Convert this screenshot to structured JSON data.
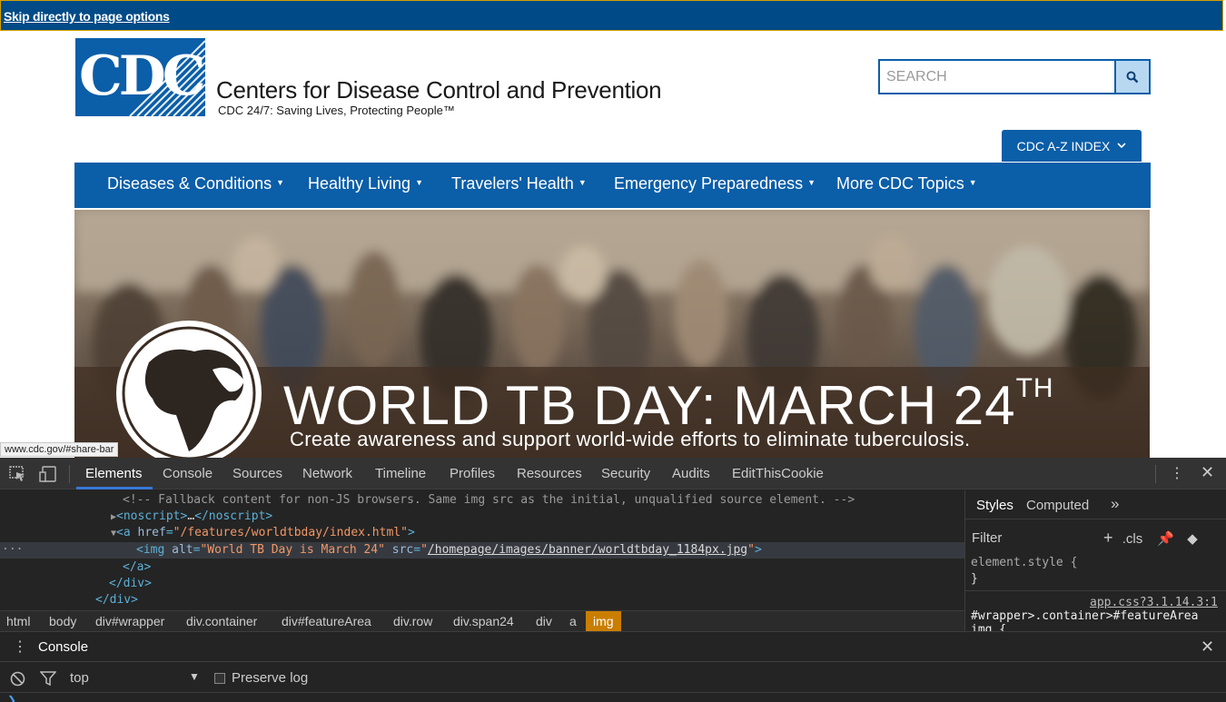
{
  "skip_link": "Skip directly to page options",
  "header": {
    "logo_text": "CDC",
    "org_name": "Centers for Disease Control and Prevention",
    "tagline": "CDC 24/7: Saving Lives, Protecting People™",
    "search_placeholder": "SEARCH",
    "az_index_label": "CDC A-Z INDEX"
  },
  "nav": {
    "items": [
      {
        "label": "Diseases & Conditions"
      },
      {
        "label": "Healthy Living"
      },
      {
        "label": "Travelers' Health"
      },
      {
        "label": "Emergency Preparedness"
      },
      {
        "label": "More CDC Topics"
      }
    ]
  },
  "banner": {
    "title": "WORLD TB DAY: MARCH 24",
    "title_sup": "TH",
    "subtitle": "Create awareness and support world-wide efforts to eliminate tuberculosis."
  },
  "status_url": "www.cdc.gov/#share-bar",
  "devtools": {
    "tabs": [
      "Elements",
      "Console",
      "Sources",
      "Network",
      "Timeline",
      "Profiles",
      "Resources",
      "Security",
      "Audits",
      "EditThisCookie"
    ],
    "active_tab": "Elements",
    "code": {
      "comment": "<!-- Fallback content for non-JS browsers. Same img src as the initial, unqualified source element. -->",
      "noscript_open": "<noscript>",
      "noscript_ellipsis": "…",
      "noscript_close": "</noscript>",
      "a_open": "<a",
      "href_attr": "href",
      "href_val": "\"/features/worldtbday/index.html\"",
      "a_gt": ">",
      "img_open": "<img",
      "alt_attr": "alt",
      "alt_val": "\"World TB Day is March 24\"",
      "src_attr": "src",
      "src_val_q1": "\"",
      "src_val": "/homepage/images/banner/worldtbday_1184px.jpg",
      "src_val_q2": "\"",
      "img_gt": ">",
      "a_close": "</a>",
      "div_close_1": "</div>",
      "div_close_2": "</div>",
      "ellipsis_gutter": "..."
    },
    "breadcrumbs": [
      "html",
      "body",
      "div#wrapper",
      "div.container",
      "div#featureArea",
      "div.row",
      "div.span24",
      "div",
      "a",
      "img"
    ],
    "styles": {
      "tabs": [
        "Styles",
        "Computed"
      ],
      "more": "»",
      "filter_label": "Filter",
      "cls_label": ".cls",
      "element_style": "element.style {",
      "close_brace": "}",
      "source_link": "app.css?3.1.14.3:1",
      "selector": "#wrapper>.container>#featureArea",
      "selector_cont": "img {"
    },
    "console": {
      "label": "Console",
      "context": "top",
      "preserve_log": "Preserve log"
    }
  },
  "colors": {
    "cdc_blue": "#0b5ea8",
    "skip_bar": "#004b87",
    "devtools_bg": "#242424",
    "active_crumb": "#c97e00"
  }
}
